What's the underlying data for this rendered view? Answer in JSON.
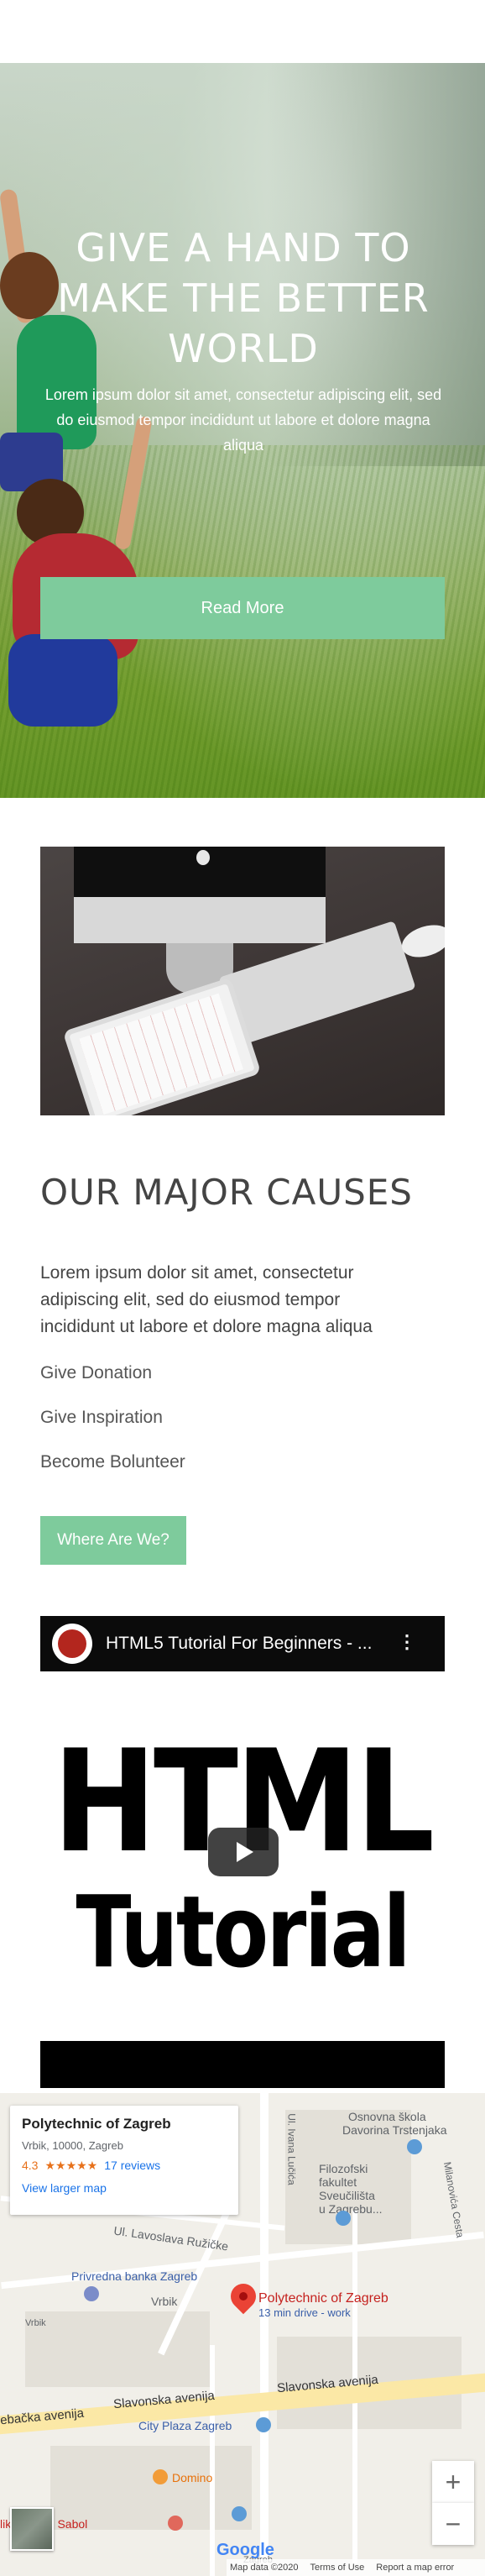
{
  "hero": {
    "title": "GIVE A HAND TO MAKE THE BETTER WORLD",
    "text": "Lorem ipsum dolor sit amet, consectetur adipiscing elit, sed do eiusmod tempor incididunt ut labore et dolore magna aliqua",
    "button_label": "Read More"
  },
  "causes": {
    "title": "OUR MAJOR CAUSES",
    "text": "Lorem ipsum dolor sit amet, consectetur adipiscing elit, sed do eiusmod tempor incididunt ut labore et dolore magna aliqua",
    "links": [
      "Give Donation",
      "Give Inspiration",
      "Become Bolunteer"
    ],
    "button_label": "Where Are We?"
  },
  "video": {
    "title": "HTML5 Tutorial For Beginners - ...",
    "thumbnail_line1": "HTML",
    "thumbnail_line2": "Tutorial",
    "menu_icon": "vertical-dots-icon",
    "play_icon": "play-icon"
  },
  "map": {
    "place_name": "Polytechnic of Zagreb",
    "address": "Vrbik, 10000, Zagreb",
    "rating": "4.3",
    "stars": "★★★★★",
    "reviews": "17 reviews",
    "larger_map": "View larger map",
    "pin_label": "Polytechnic of Zagreb",
    "pin_sublabel": "13 min drive - work",
    "labels": {
      "school": "Osnovna škola",
      "school2": "Davorina Trstenjaka",
      "faculty1": "Filozofski",
      "faculty2": "fakultet",
      "faculty3": "Sveučilišta",
      "faculty4": "u Zagrebu...",
      "bank": "Privredna banka Zagreb",
      "street_lavoslava": "Ul. Lavoslava Ružičke",
      "street_ivana": "Ul. Ivana Lučića",
      "street_vrbik": "Vrbik",
      "street_vrbik2": "Vrbik",
      "street_slavonska1": "Slavonska avenija",
      "street_slavonska2": "Slavonska avenija",
      "street_ebacka": "ebačka avenija",
      "mall": "City Plaza Zagreb",
      "domino": "Domino",
      "hospital": "liklinika dr. Sabol",
      "milanovi": "Milanovića Cesta",
      "zagreb_small": "Zagreb"
    },
    "zoom_in": "+",
    "zoom_out": "−",
    "google": "Google",
    "footer": {
      "map_data": "Map data ©2020",
      "terms": "Terms of Use",
      "report": "Report a map error"
    }
  },
  "colors": {
    "accent": "#7ecb9c",
    "text": "#444444",
    "link": "#1a73e8",
    "pin": "#ea4335"
  }
}
